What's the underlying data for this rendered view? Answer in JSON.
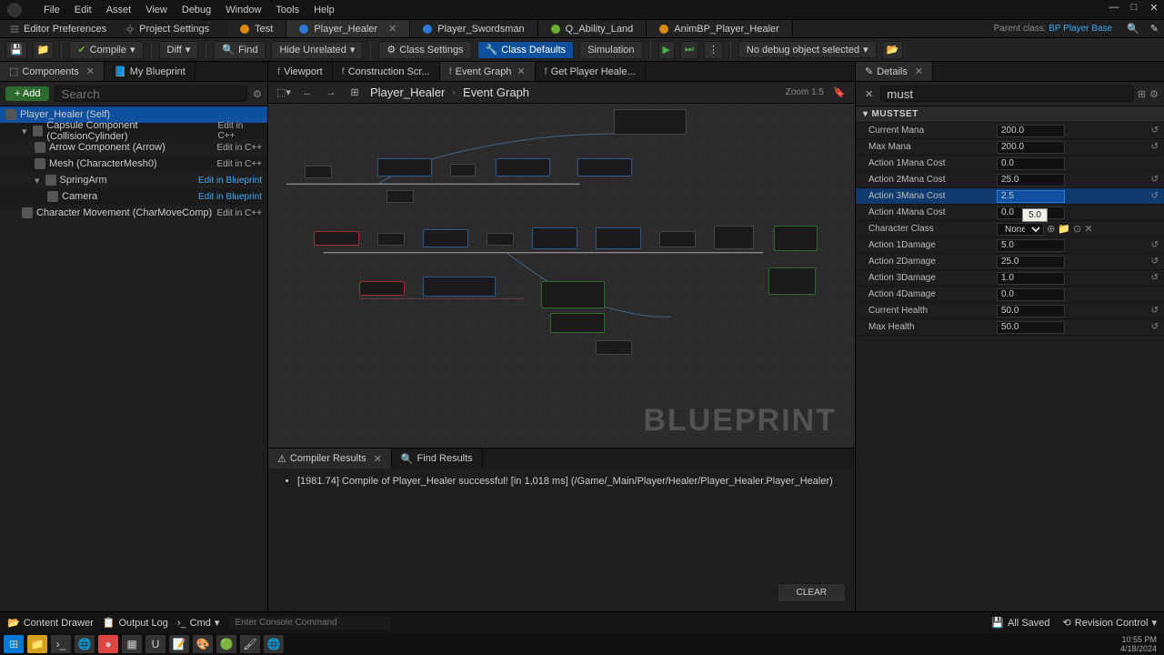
{
  "menu": [
    "File",
    "Edit",
    "Asset",
    "View",
    "Debug",
    "Window",
    "Tools",
    "Help"
  ],
  "prefs": {
    "editor": "Editor Preferences",
    "project": "Project Settings"
  },
  "file_tabs": [
    {
      "label": "Test",
      "color": "#d68b0e",
      "active": false
    },
    {
      "label": "Player_Healer",
      "color": "#2a7ad4",
      "active": true,
      "closeable": true
    },
    {
      "label": "Player_Swordsman",
      "color": "#2a7ad4",
      "active": false
    },
    {
      "label": "Q_Ability_Land",
      "color": "#6aaf2d",
      "active": false
    },
    {
      "label": "AnimBP_Player_Healer",
      "color": "#d68b0e",
      "active": false
    }
  ],
  "parent": {
    "label": "Parent class:",
    "link": "BP Player Base"
  },
  "toolbar": {
    "compile": "Compile",
    "diff": "Diff",
    "find": "Find",
    "hide": "Hide Unrelated",
    "class_settings": "Class Settings",
    "class_defaults": "Class Defaults",
    "simulation": "Simulation",
    "debug_selector": "No debug object selected"
  },
  "left": {
    "comp_tab": "Components",
    "bp_tab": "My Blueprint",
    "add": "Add",
    "search_ph": "Search",
    "tree": [
      {
        "label": "Player_Healer (Self)",
        "sel": true,
        "depth": 0
      },
      {
        "label": "Capsule Component (CollisionCylinder)",
        "link": "Edit in C++",
        "depth": 1,
        "caret": true
      },
      {
        "label": "Arrow Component (Arrow)",
        "link": "Edit in C++",
        "depth": 2
      },
      {
        "label": "Mesh (CharacterMesh0)",
        "link": "Edit in C++",
        "depth": 2
      },
      {
        "label": "SpringArm",
        "link": "Edit in Blueprint",
        "depth": 2,
        "caret": true,
        "bp": true
      },
      {
        "label": "Camera",
        "link": "Edit in Blueprint",
        "depth": 3,
        "bp": true
      },
      {
        "label": "Character Movement (CharMoveComp)",
        "link": "Edit in C++",
        "depth": 1
      }
    ]
  },
  "center": {
    "tabs": [
      {
        "label": "Viewport"
      },
      {
        "label": "Construction Scr..."
      },
      {
        "label": "Event Graph",
        "active": true,
        "close": true
      },
      {
        "label": "Get Player Heale..."
      }
    ],
    "bc_root": "Player_Healer",
    "bc_leaf": "Event Graph",
    "zoom": "Zoom 1:5",
    "watermark": "BLUEPRINT"
  },
  "compiler": {
    "tab1": "Compiler Results",
    "tab2": "Find Results",
    "msg": "[1981.74] Compile of Player_Healer successful! [in 1,018 ms] (/Game/_Main/Player/Healer/Player_Healer.Player_Healer)",
    "clear": "CLEAR"
  },
  "details": {
    "tab": "Details",
    "search": "must",
    "category": "MUSTSET",
    "props": [
      {
        "k": "Current Mana",
        "v": "200.0",
        "reset": true
      },
      {
        "k": "Max Mana",
        "v": "200.0",
        "reset": true
      },
      {
        "k": "Action 1Mana Cost",
        "v": "0.0"
      },
      {
        "k": "Action 2Mana Cost",
        "v": "25.0",
        "reset": true
      },
      {
        "k": "Action 3Mana Cost",
        "v": "2.5",
        "active": true,
        "reset": true
      },
      {
        "k": "Action 4Mana Cost",
        "v": "0.0"
      },
      {
        "k": "Character Class",
        "select": "None",
        "icons": true
      },
      {
        "k": "Action 1Damage",
        "v": "5.0",
        "reset": true
      },
      {
        "k": "Action 2Damage",
        "v": "25.0",
        "reset": true
      },
      {
        "k": "Action 3Damage",
        "v": "1.0",
        "reset": true
      },
      {
        "k": "Action 4Damage",
        "v": "0.0"
      },
      {
        "k": "Current Health",
        "v": "50.0",
        "reset": true
      },
      {
        "k": "Max Health",
        "v": "50.0",
        "reset": true
      }
    ],
    "tooltip": "5.0"
  },
  "status": {
    "drawer": "Content Drawer",
    "log": "Output Log",
    "cmd_label": "Cmd",
    "cmd_ph": "Enter Console Command",
    "saved": "All Saved",
    "rev": "Revision Control"
  },
  "taskbar": {
    "time": "10:55 PM",
    "date": "4/18/2024"
  }
}
